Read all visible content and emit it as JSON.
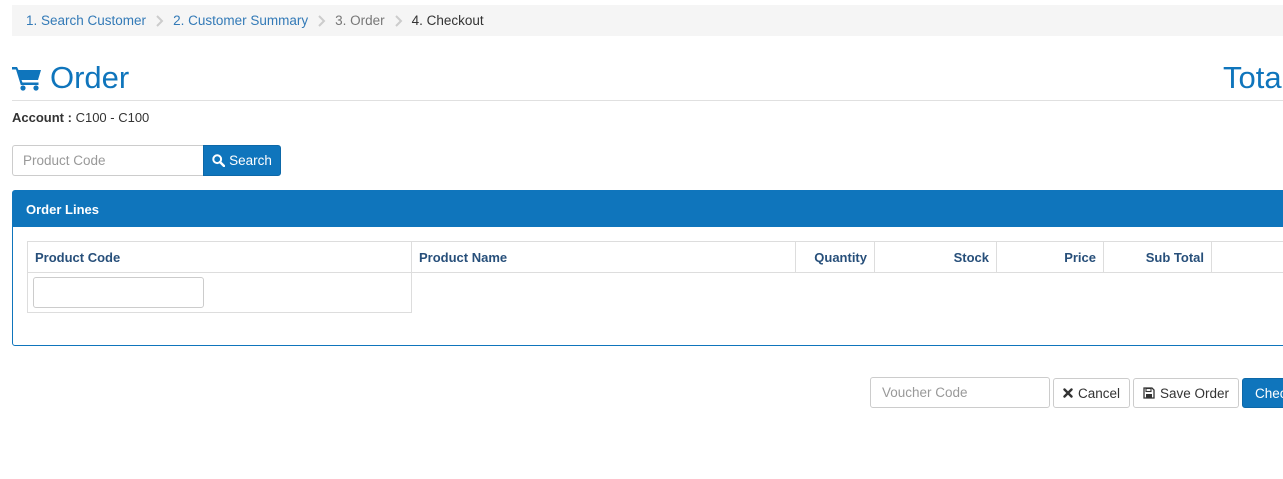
{
  "breadcrumb": {
    "items": [
      {
        "label": "1. Search Customer"
      },
      {
        "label": "2. Customer Summary"
      },
      {
        "label": "3. Order"
      },
      {
        "label": "4. Checkout"
      }
    ],
    "separator_icon": "chevron-right-icon"
  },
  "header": {
    "title": "Order",
    "title_icon": "shopping-cart-icon",
    "total_label": "Tota"
  },
  "account": {
    "label": "Account :",
    "value": "C100 - C100"
  },
  "product_search": {
    "placeholder": "Product Code",
    "value": "",
    "button_label": "Search",
    "button_icon": "search-icon"
  },
  "order_lines": {
    "title": "Order Lines",
    "columns": [
      "Product Code",
      "Product Name",
      "Quantity",
      "Stock",
      "Price",
      "Sub Total",
      ""
    ],
    "new_line_product_code": ""
  },
  "footer": {
    "voucher_placeholder": "Voucher Code",
    "voucher_value": "",
    "cancel_label": "Cancel",
    "cancel_icon": "close-icon",
    "save_label": "Save Order",
    "save_icon": "floppy-disk-icon",
    "checkout_label": "Chec"
  },
  "colors": {
    "primary": "#0f75bc",
    "link": "#337ab7",
    "breadcrumb_bg": "#f5f5f5",
    "table_header_text": "#274f7a"
  }
}
